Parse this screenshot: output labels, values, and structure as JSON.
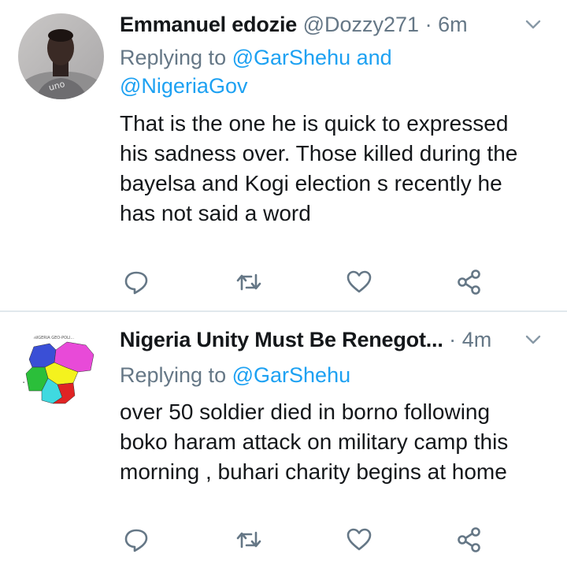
{
  "tweets": [
    {
      "name": "Emmanuel edozie",
      "handle": "@Dozzy271",
      "dot": "·",
      "time": "6m",
      "replying_prefix": "Replying to",
      "mentions": [
        "@GarShehu",
        "@NigeriaGov"
      ],
      "mention_joiner": "and",
      "lines": [
        "That is the one he is quick to expressed",
        "his sadness over. Those killed during the",
        "bayelsa and Kogi election s recently he",
        "has not said a word"
      ],
      "avatar_icon": "profile-photo",
      "avatar_text": "uno"
    },
    {
      "name": "Nigeria Unity Must Be Renegot...",
      "handle": "",
      "dot": "·",
      "time": "4m",
      "replying_prefix": "Replying to",
      "mentions": [
        "@GarShehu"
      ],
      "lines": [
        "over 50 soldier died in borno following",
        "boko haram attack on military camp  this",
        "morning , buhari charity begins at home"
      ],
      "avatar_icon": "nigeria-geopolitical-map",
      "avatar_text": "NIGERIA GEO-POLI..."
    }
  ],
  "icons": {
    "reply": "reply-icon",
    "retweet": "retweet-icon",
    "like": "heart-icon",
    "share": "share-icon",
    "menu": "chevron-down-icon"
  },
  "colors": {
    "name": "#14171a",
    "meta": "#657786",
    "mention": "#1da1f2",
    "divider": "#e1e8ed",
    "icon": "#657786"
  }
}
